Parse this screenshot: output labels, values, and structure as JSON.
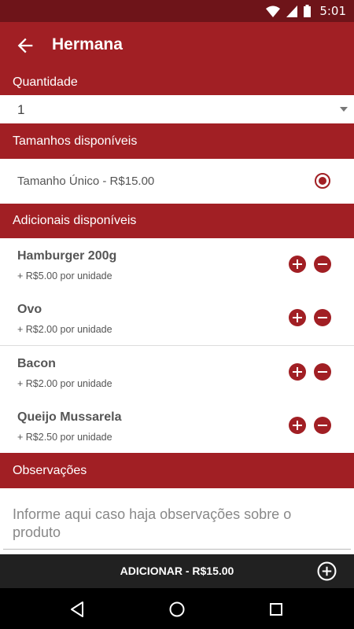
{
  "statusbar": {
    "time": "5:01"
  },
  "appbar": {
    "title": "Hermana"
  },
  "quantity": {
    "header": "Quantidade",
    "value": "1"
  },
  "sizes": {
    "header": "Tamanhos disponíveis",
    "items": [
      {
        "label": "Tamanho Único - R$15.00",
        "selected": true
      }
    ]
  },
  "addons": {
    "header": "Adicionais disponíveis",
    "items": [
      {
        "name": "Hamburger 200g",
        "price": "+ R$5.00 por unidade"
      },
      {
        "name": "Ovo",
        "price": "+ R$2.00 por unidade"
      },
      {
        "name": "Bacon",
        "price": "+ R$2.00 por unidade"
      },
      {
        "name": "Queijo Mussarela",
        "price": "+ R$2.50 por unidade"
      }
    ]
  },
  "observations": {
    "header": "Observações",
    "placeholder": "Informe aqui caso haja observações sobre o produto"
  },
  "add_bar": {
    "label": "ADICIONAR - R$15.00"
  },
  "colors": {
    "primary": "#a11f24",
    "status": "#6e1419",
    "addbar": "#212121"
  }
}
